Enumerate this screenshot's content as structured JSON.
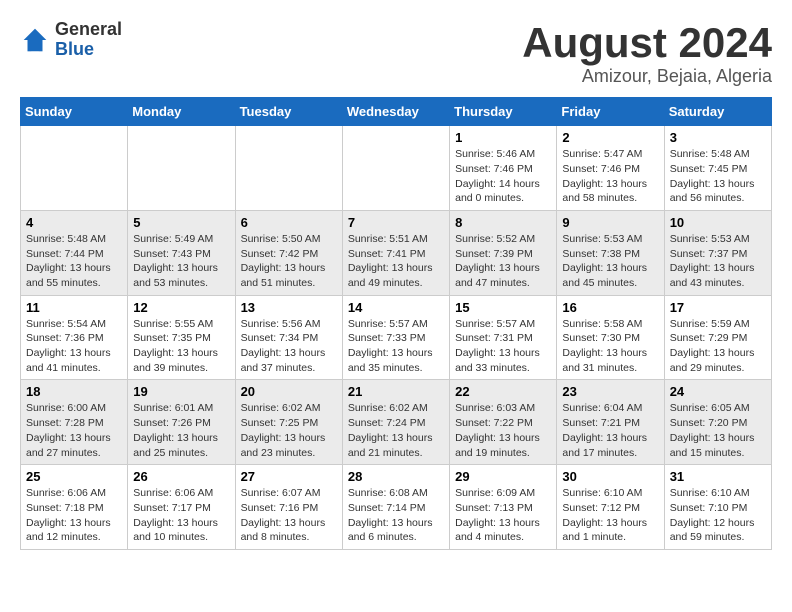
{
  "header": {
    "logo": {
      "general": "General",
      "blue": "Blue"
    },
    "title": "August 2024",
    "location": "Amizour, Bejaia, Algeria"
  },
  "calendar": {
    "days": [
      "Sunday",
      "Monday",
      "Tuesday",
      "Wednesday",
      "Thursday",
      "Friday",
      "Saturday"
    ],
    "weeks": [
      [
        {
          "date": "",
          "info": ""
        },
        {
          "date": "",
          "info": ""
        },
        {
          "date": "",
          "info": ""
        },
        {
          "date": "",
          "info": ""
        },
        {
          "date": "1",
          "info": "Sunrise: 5:46 AM\nSunset: 7:46 PM\nDaylight: 14 hours\nand 0 minutes."
        },
        {
          "date": "2",
          "info": "Sunrise: 5:47 AM\nSunset: 7:46 PM\nDaylight: 13 hours\nand 58 minutes."
        },
        {
          "date": "3",
          "info": "Sunrise: 5:48 AM\nSunset: 7:45 PM\nDaylight: 13 hours\nand 56 minutes."
        }
      ],
      [
        {
          "date": "4",
          "info": "Sunrise: 5:48 AM\nSunset: 7:44 PM\nDaylight: 13 hours\nand 55 minutes."
        },
        {
          "date": "5",
          "info": "Sunrise: 5:49 AM\nSunset: 7:43 PM\nDaylight: 13 hours\nand 53 minutes."
        },
        {
          "date": "6",
          "info": "Sunrise: 5:50 AM\nSunset: 7:42 PM\nDaylight: 13 hours\nand 51 minutes."
        },
        {
          "date": "7",
          "info": "Sunrise: 5:51 AM\nSunset: 7:41 PM\nDaylight: 13 hours\nand 49 minutes."
        },
        {
          "date": "8",
          "info": "Sunrise: 5:52 AM\nSunset: 7:39 PM\nDaylight: 13 hours\nand 47 minutes."
        },
        {
          "date": "9",
          "info": "Sunrise: 5:53 AM\nSunset: 7:38 PM\nDaylight: 13 hours\nand 45 minutes."
        },
        {
          "date": "10",
          "info": "Sunrise: 5:53 AM\nSunset: 7:37 PM\nDaylight: 13 hours\nand 43 minutes."
        }
      ],
      [
        {
          "date": "11",
          "info": "Sunrise: 5:54 AM\nSunset: 7:36 PM\nDaylight: 13 hours\nand 41 minutes."
        },
        {
          "date": "12",
          "info": "Sunrise: 5:55 AM\nSunset: 7:35 PM\nDaylight: 13 hours\nand 39 minutes."
        },
        {
          "date": "13",
          "info": "Sunrise: 5:56 AM\nSunset: 7:34 PM\nDaylight: 13 hours\nand 37 minutes."
        },
        {
          "date": "14",
          "info": "Sunrise: 5:57 AM\nSunset: 7:33 PM\nDaylight: 13 hours\nand 35 minutes."
        },
        {
          "date": "15",
          "info": "Sunrise: 5:57 AM\nSunset: 7:31 PM\nDaylight: 13 hours\nand 33 minutes."
        },
        {
          "date": "16",
          "info": "Sunrise: 5:58 AM\nSunset: 7:30 PM\nDaylight: 13 hours\nand 31 minutes."
        },
        {
          "date": "17",
          "info": "Sunrise: 5:59 AM\nSunset: 7:29 PM\nDaylight: 13 hours\nand 29 minutes."
        }
      ],
      [
        {
          "date": "18",
          "info": "Sunrise: 6:00 AM\nSunset: 7:28 PM\nDaylight: 13 hours\nand 27 minutes."
        },
        {
          "date": "19",
          "info": "Sunrise: 6:01 AM\nSunset: 7:26 PM\nDaylight: 13 hours\nand 25 minutes."
        },
        {
          "date": "20",
          "info": "Sunrise: 6:02 AM\nSunset: 7:25 PM\nDaylight: 13 hours\nand 23 minutes."
        },
        {
          "date": "21",
          "info": "Sunrise: 6:02 AM\nSunset: 7:24 PM\nDaylight: 13 hours\nand 21 minutes."
        },
        {
          "date": "22",
          "info": "Sunrise: 6:03 AM\nSunset: 7:22 PM\nDaylight: 13 hours\nand 19 minutes."
        },
        {
          "date": "23",
          "info": "Sunrise: 6:04 AM\nSunset: 7:21 PM\nDaylight: 13 hours\nand 17 minutes."
        },
        {
          "date": "24",
          "info": "Sunrise: 6:05 AM\nSunset: 7:20 PM\nDaylight: 13 hours\nand 15 minutes."
        }
      ],
      [
        {
          "date": "25",
          "info": "Sunrise: 6:06 AM\nSunset: 7:18 PM\nDaylight: 13 hours\nand 12 minutes."
        },
        {
          "date": "26",
          "info": "Sunrise: 6:06 AM\nSunset: 7:17 PM\nDaylight: 13 hours\nand 10 minutes."
        },
        {
          "date": "27",
          "info": "Sunrise: 6:07 AM\nSunset: 7:16 PM\nDaylight: 13 hours\nand 8 minutes."
        },
        {
          "date": "28",
          "info": "Sunrise: 6:08 AM\nSunset: 7:14 PM\nDaylight: 13 hours\nand 6 minutes."
        },
        {
          "date": "29",
          "info": "Sunrise: 6:09 AM\nSunset: 7:13 PM\nDaylight: 13 hours\nand 4 minutes."
        },
        {
          "date": "30",
          "info": "Sunrise: 6:10 AM\nSunset: 7:12 PM\nDaylight: 13 hours\nand 1 minute."
        },
        {
          "date": "31",
          "info": "Sunrise: 6:10 AM\nSunset: 7:10 PM\nDaylight: 12 hours\nand 59 minutes."
        }
      ]
    ]
  }
}
